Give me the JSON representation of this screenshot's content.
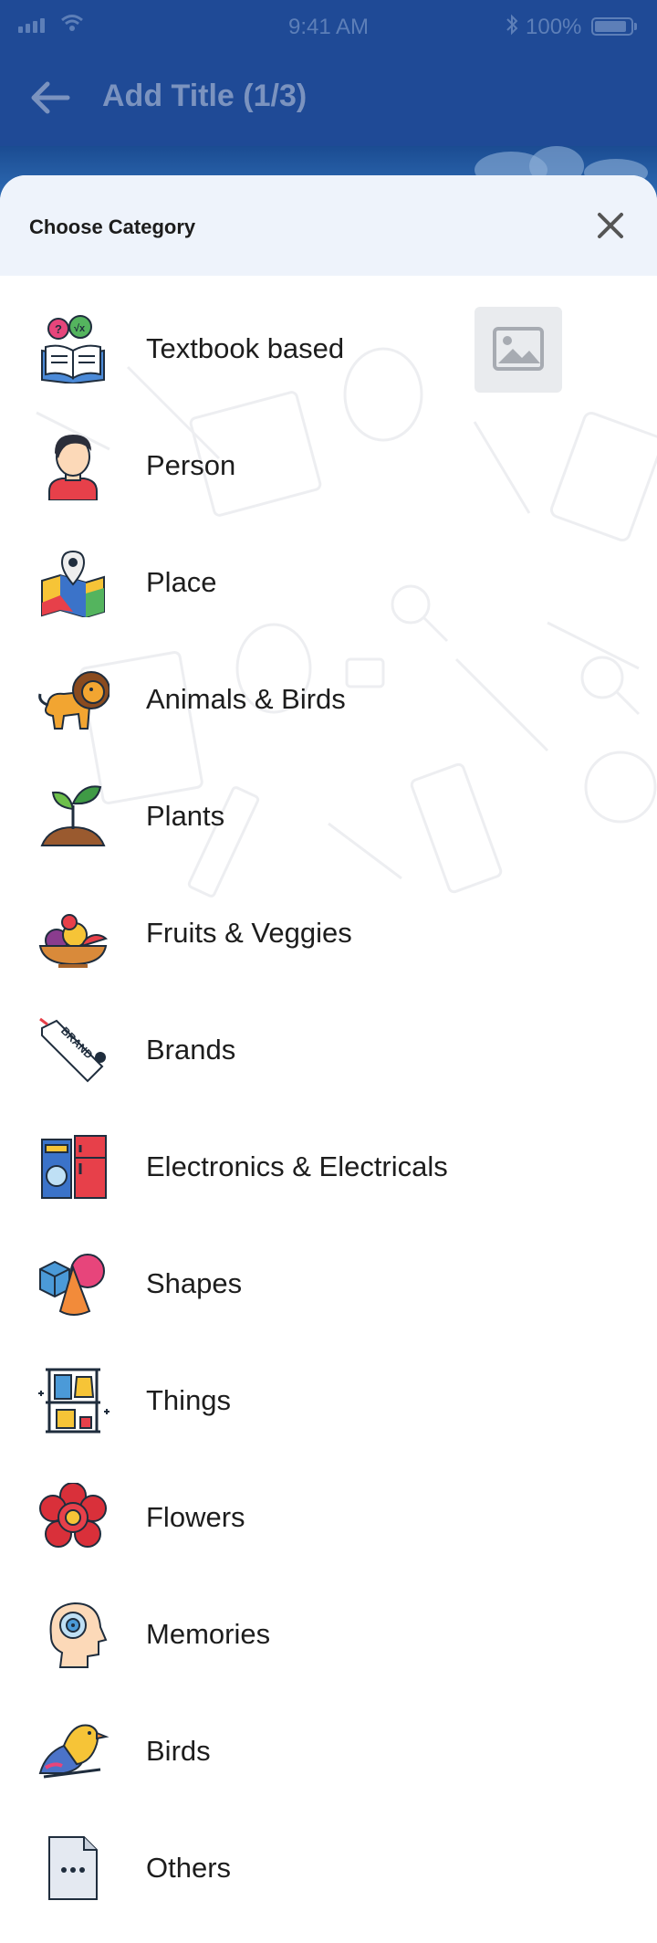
{
  "status_bar": {
    "time": "9:41 AM",
    "battery": "100%"
  },
  "app_bar": {
    "title": "Add Title (1/3)"
  },
  "sheet": {
    "title": "Choose Category",
    "categories": [
      {
        "label": "Textbook based",
        "icon": "textbook-icon"
      },
      {
        "label": "Person",
        "icon": "person-icon"
      },
      {
        "label": "Place",
        "icon": "place-map-icon"
      },
      {
        "label": "Animals & Birds",
        "icon": "lion-icon"
      },
      {
        "label": "Plants",
        "icon": "sprout-icon"
      },
      {
        "label": "Fruits & Veggies",
        "icon": "fruit-bowl-icon"
      },
      {
        "label": "Brands",
        "icon": "brand-tag-icon"
      },
      {
        "label": "Electronics & Electricals",
        "icon": "appliances-icon"
      },
      {
        "label": "Shapes",
        "icon": "shapes-icon"
      },
      {
        "label": "Things",
        "icon": "things-shelf-icon"
      },
      {
        "label": "Flowers",
        "icon": "flower-icon"
      },
      {
        "label": "Memories",
        "icon": "memory-head-icon"
      },
      {
        "label": "Birds",
        "icon": "bird-icon"
      },
      {
        "label": "Others",
        "icon": "others-file-icon"
      }
    ]
  },
  "colors": {
    "app_bar": "#1f4a96",
    "sheet_header": "#eef3fb",
    "text": "#1d1d1d"
  }
}
